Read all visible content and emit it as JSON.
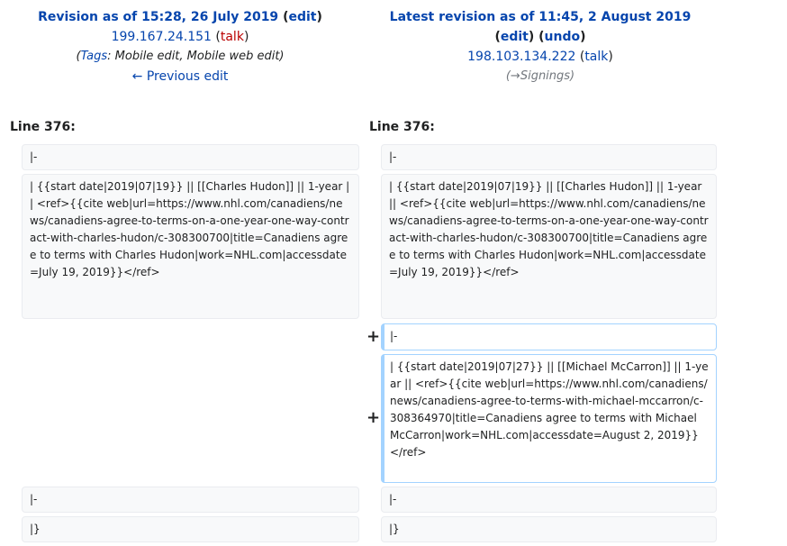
{
  "left_header": {
    "title_prefix": "Revision as of 15:28, 26 July 2019",
    "edit_label": "edit",
    "user": "199.167.24.151",
    "talk_label": "talk",
    "tags_label": "Tags",
    "tags_text": ": Mobile edit, Mobile web edit)",
    "prev_edit": "← Previous edit"
  },
  "right_header": {
    "title": "Latest revision as of 11:45, 2 August 2019",
    "edit_label": "edit",
    "undo_label": "undo",
    "user": "198.103.134.222",
    "talk_label": "talk",
    "summary": "(→Signings)"
  },
  "left_line_no": "Line 376:",
  "right_line_no": "Line 376:",
  "markers": {
    "added": "+"
  },
  "diff": {
    "ctx1": "|-",
    "ctx2": "| {{start date|2019|07|19}} || [[Charles Hudon]] || 1-year || <ref>{{cite web|url=https://www.nhl.com/canadiens/news/canadiens-agree-to-terms-on-a-one-year-one-way-contract-with-charles-hudon/c-308300700|title=Canadiens agree to terms with Charles Hudon|work=NHL.com|accessdate=July 19, 2019}}</ref>",
    "add1": "|-",
    "add2": "| {{start date|2019|07|27}} || [[Michael McCarron]] || 1-year || <ref>{{cite web|url=https://www.nhl.com/canadiens/news/canadiens-agree-to-terms-with-michael-mccarron/c-308364970|title=Canadiens agree to terms with Michael McCarron|work=NHL.com|accessdate=August 2, 2019}}</ref>",
    "ctx3": "|-",
    "ctx4": "|}"
  }
}
